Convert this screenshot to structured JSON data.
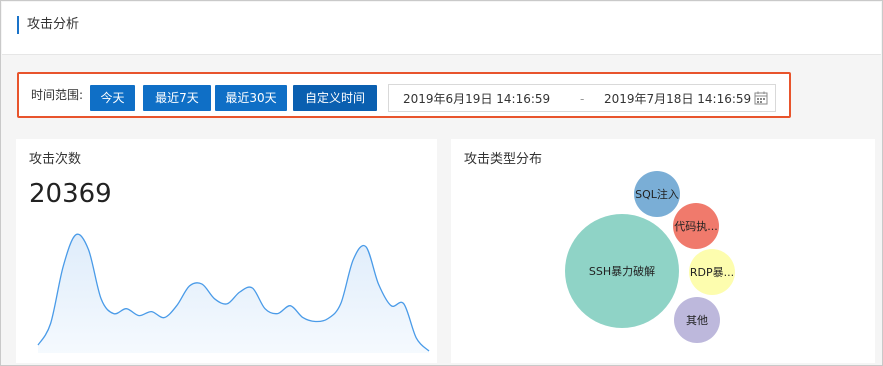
{
  "header": {
    "title": "攻击分析"
  },
  "filter": {
    "label": "时间范围:",
    "buttons": [
      "今天",
      "最近7天",
      "最近30天",
      "自定义时间"
    ],
    "active_index": 3,
    "start": "2019年6月19日 14:16:59",
    "separator": "-",
    "end": "2019年7月18日 14:16:59",
    "calendar_icon": "calendar-icon"
  },
  "attack_count": {
    "title": "攻击次数",
    "value": "20369"
  },
  "attack_types": {
    "title": "攻击类型分布",
    "bubbles": [
      {
        "label": "SSH暴力破解",
        "color": "#8fd3c6"
      },
      {
        "label": "SQL注入",
        "color": "#7aaed6"
      },
      {
        "label": "代码执...",
        "color": "#f07a6c"
      },
      {
        "label": "RDP暴...",
        "color": "#fdfdae"
      },
      {
        "label": "其他",
        "color": "#bdb8dc"
      }
    ]
  },
  "chart_data": {
    "type": "area",
    "title": "",
    "values": [
      8,
      30,
      88,
      120,
      105,
      55,
      40,
      45,
      38,
      42,
      36,
      48,
      68,
      70,
      55,
      50,
      62,
      66,
      45,
      40,
      48,
      36,
      32,
      35,
      50,
      95,
      108,
      70,
      48,
      50,
      15,
      2
    ],
    "ylim": [
      0,
      130
    ],
    "color": "#4a9be8",
    "fill": "#e8f2fc"
  }
}
